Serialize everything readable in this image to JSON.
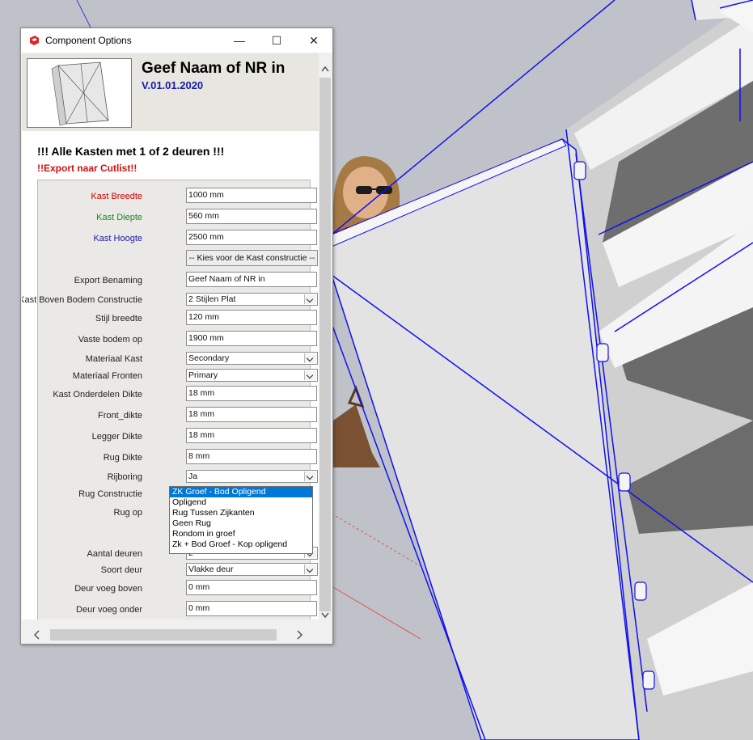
{
  "window": {
    "title": "Component Options",
    "minimize_glyph": "—",
    "maximize_glyph": "☐",
    "close_glyph": "✕"
  },
  "header": {
    "title": "Geef Naam of NR in",
    "version": "V.01.01.2020"
  },
  "subtitle": "!!! Alle Kasten met 1 of 2 deuren !!!",
  "export_note": "!!Export naar Cutlist!!",
  "colors": {
    "accent_blue": "#1a1aa8",
    "red": "#cc0000",
    "green": "#1b8a1b",
    "highlight": "#0078d7"
  },
  "form": {
    "kast_breedte": {
      "label": "Kast Breedte",
      "value": "1000 mm"
    },
    "kast_diepte": {
      "label": "Kast Diepte",
      "value": "560 mm"
    },
    "kast_hoogte": {
      "label": "Kast Hoogte",
      "value": "2500 mm"
    },
    "kies_button": "-- Kies voor de Kast constructie --",
    "export_benaming": {
      "label": "Export Benaming",
      "value": "Geef Naam of NR in"
    },
    "boven_bodem": {
      "label": "Kast Boven Bodem Constructie",
      "value": "2 Stijlen Plat"
    },
    "stijl_breedte": {
      "label": "Stijl breedte",
      "value": "120 mm"
    },
    "vaste_bodem": {
      "label": "Vaste bodem op",
      "value": "1900 mm"
    },
    "materiaal_kast": {
      "label": "Materiaal Kast",
      "value": "Secondary"
    },
    "materiaal_fronten": {
      "label": "Materiaal Fronten",
      "value": "Primary"
    },
    "onderdelen_dikte": {
      "label": "Kast Onderdelen Dikte",
      "value": "18 mm"
    },
    "front_dikte": {
      "label": "Front_dikte",
      "value": "18 mm"
    },
    "legger_dikte": {
      "label": "Legger Dikte",
      "value": "18 mm"
    },
    "rug_dikte": {
      "label": "Rug Dikte",
      "value": "8 mm"
    },
    "rijboring": {
      "label": "Rijboring",
      "value": "Ja"
    },
    "rug_constructie": {
      "label": "Rug Constructie"
    },
    "rug_op": {
      "label": "Rug op"
    },
    "aantal_deuren": {
      "label": "Aantal deuren",
      "value": "2"
    },
    "soort_deur": {
      "label": "Soort deur",
      "value": "Vlakke deur"
    },
    "deur_voeg_boven": {
      "label": "Deur voeg boven",
      "value": "0 mm"
    },
    "deur_voeg_onder": {
      "label": "Deur voeg onder",
      "value": "0 mm"
    }
  },
  "dropdown_options": [
    "ZK Groef - Bod Opligend",
    "Opligend",
    "Rug Tussen Zijkanten",
    "Geen Rug",
    "Rondom in groef",
    "Zk + Bod Groef - Kop opligend"
  ]
}
